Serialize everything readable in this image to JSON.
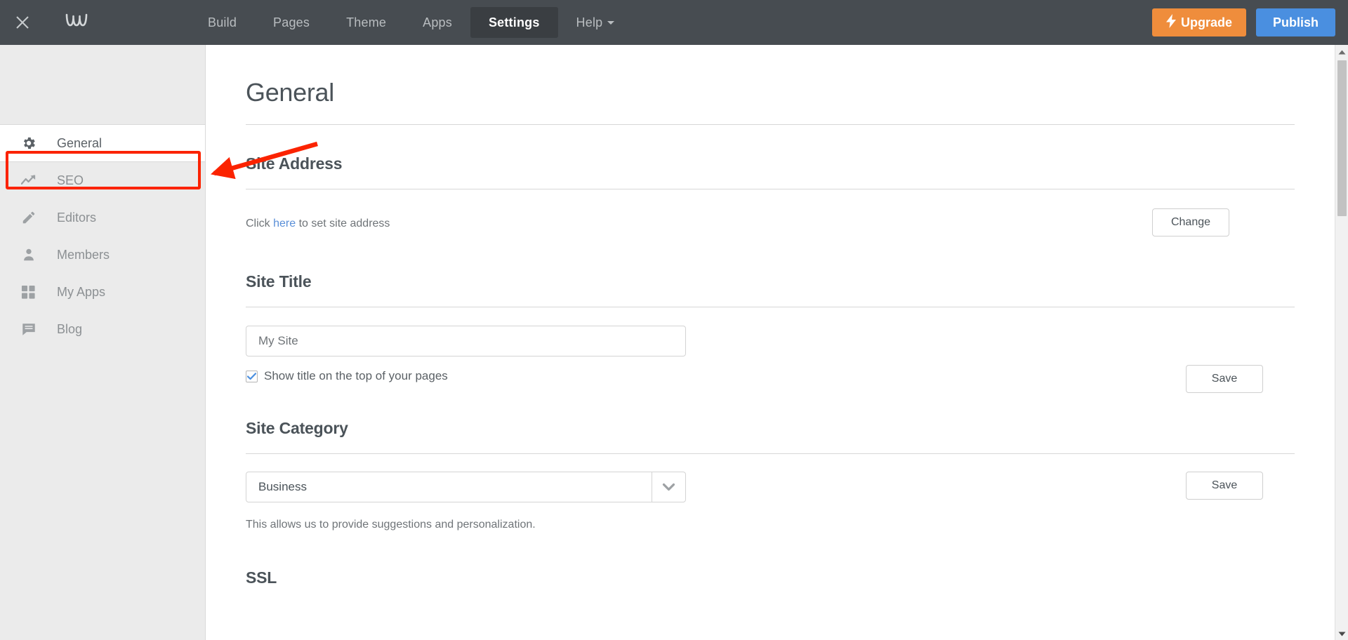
{
  "topbar": {
    "close_icon": "close-icon",
    "logo": "weebly-w-logo",
    "nav": [
      {
        "label": "Build",
        "active": false,
        "caret": false
      },
      {
        "label": "Pages",
        "active": false,
        "caret": false
      },
      {
        "label": "Theme",
        "active": false,
        "caret": false
      },
      {
        "label": "Apps",
        "active": false,
        "caret": false
      },
      {
        "label": "Settings",
        "active": true,
        "caret": false
      },
      {
        "label": "Help",
        "active": false,
        "caret": true
      }
    ],
    "upgrade_label": "Upgrade",
    "publish_label": "Publish",
    "upgrade_color": "#ef8d3c",
    "publish_color": "#4a8fe0",
    "background_color": "#474c51"
  },
  "sidebar": {
    "items": [
      {
        "label": "General",
        "icon": "gear-icon",
        "active": true
      },
      {
        "label": "SEO",
        "icon": "trend-up-icon",
        "active": false
      },
      {
        "label": "Editors",
        "icon": "pencil-icon",
        "active": false
      },
      {
        "label": "Members",
        "icon": "person-icon",
        "active": false
      },
      {
        "label": "My Apps",
        "icon": "grid-icon",
        "active": false
      },
      {
        "label": "Blog",
        "icon": "chat-icon",
        "active": false
      }
    ]
  },
  "main": {
    "page_title": "General",
    "site_address": {
      "heading": "Site Address",
      "text_before": "Click ",
      "link": "here",
      "text_after": " to set site address",
      "button": "Change"
    },
    "site_title": {
      "heading": "Site Title",
      "value": "My Site",
      "placeholder": "My Site",
      "checkbox_label": "Show title on the top of your pages",
      "checkbox_checked": true,
      "button": "Save"
    },
    "site_category": {
      "heading": "Site Category",
      "selected": "Business",
      "note": "This allows us to provide suggestions and personalization.",
      "button": "Save"
    },
    "ssl": {
      "heading": "SSL"
    }
  },
  "annotation": {
    "color": "#fb2300",
    "target": "sidebar-item-seo",
    "shape": "rectangle-with-arrow"
  },
  "scrollbar": {
    "up_icon": "caret-up-icon",
    "down_icon": "caret-down-icon"
  }
}
